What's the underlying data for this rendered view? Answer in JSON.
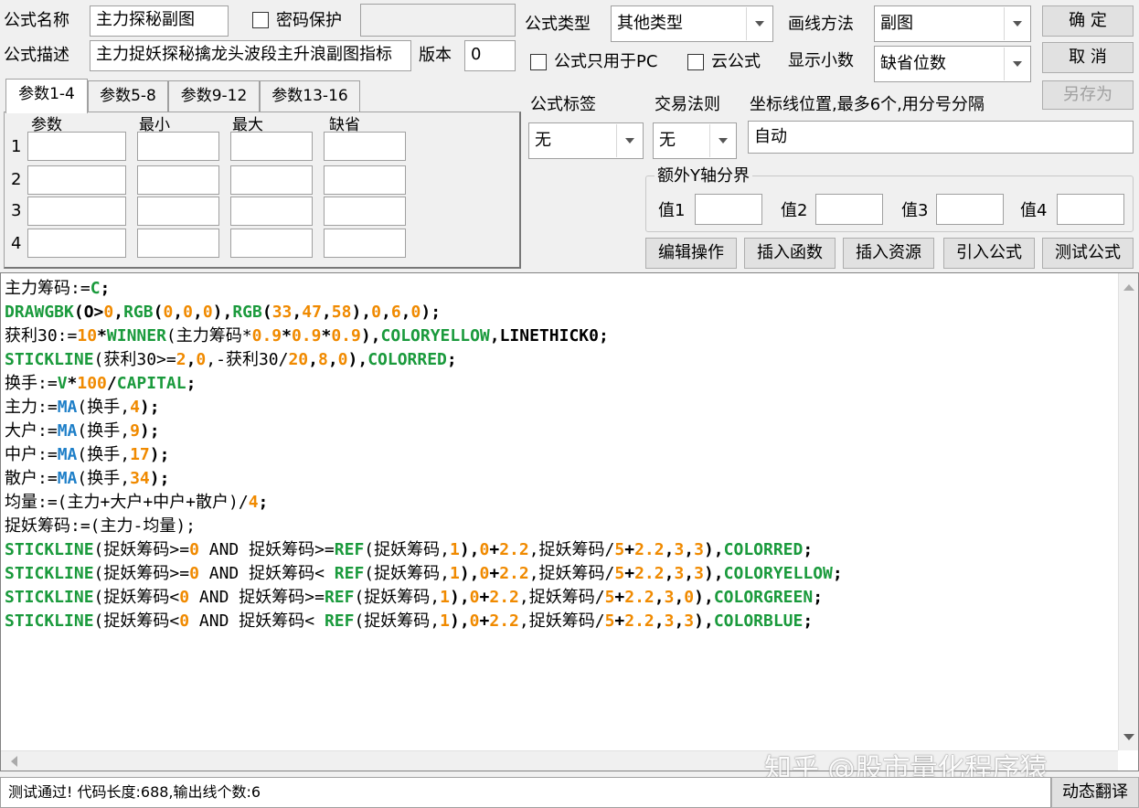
{
  "header": {
    "name_label": "公式名称",
    "name_value": "主力探秘副图",
    "pwd_label": "密码保护",
    "desc_label": "公式描述",
    "desc_value": "主力捉妖探秘擒龙头波段主升浪副图指标",
    "version_label": "版本",
    "version_value": "0"
  },
  "formula_type": {
    "label": "公式类型",
    "value": "其他类型"
  },
  "draw_method": {
    "label": "画线方法",
    "value": "副图"
  },
  "pc_only_label": "公式只用于PC",
  "cloud_label": "云公式",
  "decimals": {
    "label": "显示小数",
    "value": "缺省位数"
  },
  "buttons": {
    "ok": "确  定",
    "cancel": "取  消",
    "save_as": "另存为"
  },
  "tabs": [
    "参数1-4",
    "参数5-8",
    "参数9-12",
    "参数13-16"
  ],
  "param_headers": [
    "参数",
    "最小",
    "最大",
    "缺省"
  ],
  "param_rows": [
    "1",
    "2",
    "3",
    "4"
  ],
  "tag": {
    "label": "公式标签",
    "value": "无"
  },
  "trade_rule": {
    "label": "交易法则",
    "value": "无"
  },
  "coord": {
    "label": "坐标线位置,最多6个,用分号分隔",
    "value": "自动"
  },
  "yaxis": {
    "label": "额外Y轴分界",
    "v1": "值1",
    "v2": "值2",
    "v3": "值3",
    "v4": "值4"
  },
  "actions": [
    "编辑操作",
    "插入函数",
    "插入资源",
    "引入公式",
    "测试公式"
  ],
  "colors": {
    "func": "#1a9a3c",
    "num": "#f08a00",
    "kw": "#1e7fc8",
    "text": "#000000"
  },
  "code_lines": [
    [
      [
        "主力筹码:=",
        "t"
      ],
      [
        "C",
        "f"
      ],
      [
        ";",
        "t"
      ]
    ],
    [
      [
        "DRAWGBK",
        "f"
      ],
      [
        "(",
        "t"
      ],
      [
        "O",
        "t"
      ],
      [
        ">",
        "t"
      ],
      [
        "0",
        "n"
      ],
      [
        ",",
        "t"
      ],
      [
        "RGB",
        "f"
      ],
      [
        "(",
        "t"
      ],
      [
        "0",
        "n"
      ],
      [
        ",",
        "t"
      ],
      [
        "0",
        "n"
      ],
      [
        ",",
        "t"
      ],
      [
        "0",
        "n"
      ],
      [
        "),",
        "t"
      ],
      [
        "RGB",
        "f"
      ],
      [
        "(",
        "t"
      ],
      [
        "33",
        "n"
      ],
      [
        ",",
        "t"
      ],
      [
        "47",
        "n"
      ],
      [
        ",",
        "t"
      ],
      [
        "58",
        "n"
      ],
      [
        "),",
        "t"
      ],
      [
        "0",
        "n"
      ],
      [
        ",",
        "t"
      ],
      [
        "6",
        "n"
      ],
      [
        ",",
        "t"
      ],
      [
        "0",
        "n"
      ],
      [
        ");",
        "t"
      ]
    ],
    [
      [
        "获利30:=",
        "t"
      ],
      [
        "10",
        "n"
      ],
      [
        "*",
        "t"
      ],
      [
        "WINNER",
        "f"
      ],
      [
        "(主力筹码*",
        "t"
      ],
      [
        "0.9",
        "n"
      ],
      [
        "*",
        "t"
      ],
      [
        "0.9",
        "n"
      ],
      [
        "*",
        "t"
      ],
      [
        "0.9",
        "n"
      ],
      [
        "),",
        "t"
      ],
      [
        "COLORYELLOW",
        "f"
      ],
      [
        ",LINETHICK0;",
        "t"
      ]
    ],
    [
      [
        "STICKLINE",
        "f"
      ],
      [
        "(获利30>=",
        "t"
      ],
      [
        "2",
        "n"
      ],
      [
        ",",
        "t"
      ],
      [
        "0",
        "n"
      ],
      [
        ",-获利30/",
        "t"
      ],
      [
        "20",
        "n"
      ],
      [
        ",",
        "t"
      ],
      [
        "8",
        "n"
      ],
      [
        ",",
        "t"
      ],
      [
        "0",
        "n"
      ],
      [
        "),",
        "t"
      ],
      [
        "COLORRED",
        "f"
      ],
      [
        ";",
        "t"
      ]
    ],
    [
      [
        "换手:=",
        "t"
      ],
      [
        "V",
        "f"
      ],
      [
        "*",
        "t"
      ],
      [
        "100",
        "n"
      ],
      [
        "/",
        "t"
      ],
      [
        "CAPITAL",
        "f"
      ],
      [
        ";",
        "t"
      ]
    ],
    [
      [
        "主力:=",
        "t"
      ],
      [
        "MA",
        "k"
      ],
      [
        "(换手,",
        "t"
      ],
      [
        "4",
        "n"
      ],
      [
        ");",
        "t"
      ]
    ],
    [
      [
        "大户:=",
        "t"
      ],
      [
        "MA",
        "k"
      ],
      [
        "(换手,",
        "t"
      ],
      [
        "9",
        "n"
      ],
      [
        ");",
        "t"
      ]
    ],
    [
      [
        "中户:=",
        "t"
      ],
      [
        "MA",
        "k"
      ],
      [
        "(换手,",
        "t"
      ],
      [
        "17",
        "n"
      ],
      [
        ");",
        "t"
      ]
    ],
    [
      [
        "散户:=",
        "t"
      ],
      [
        "MA",
        "k"
      ],
      [
        "(换手,",
        "t"
      ],
      [
        "34",
        "n"
      ],
      [
        ");",
        "t"
      ]
    ],
    [
      [
        "均量:=(主力+大户+中户+散户)/",
        "t"
      ],
      [
        "4",
        "n"
      ],
      [
        ";",
        "t"
      ]
    ],
    [
      [
        "捉妖筹码:=(主力-均量);",
        "t"
      ]
    ],
    [
      [
        "STICKLINE",
        "f"
      ],
      [
        "(捉妖筹码>=",
        "t"
      ],
      [
        "0",
        "n"
      ],
      [
        " AND 捉妖筹码>=",
        "t"
      ],
      [
        "REF",
        "f"
      ],
      [
        "(捉妖筹码,",
        "t"
      ],
      [
        "1",
        "n"
      ],
      [
        "),",
        "t"
      ],
      [
        "0",
        "n"
      ],
      [
        "+",
        "t"
      ],
      [
        "2.2",
        "n"
      ],
      [
        ",捉妖筹码/",
        "t"
      ],
      [
        "5",
        "n"
      ],
      [
        "+",
        "t"
      ],
      [
        "2.2",
        "n"
      ],
      [
        ",",
        "t"
      ],
      [
        "3",
        "n"
      ],
      [
        ",",
        "t"
      ],
      [
        "3",
        "n"
      ],
      [
        "),",
        "t"
      ],
      [
        "COLORRED",
        "f"
      ],
      [
        ";",
        "t"
      ]
    ],
    [
      [
        "STICKLINE",
        "f"
      ],
      [
        "(捉妖筹码>=",
        "t"
      ],
      [
        "0",
        "n"
      ],
      [
        " AND 捉妖筹码< ",
        "t"
      ],
      [
        "REF",
        "f"
      ],
      [
        "(捉妖筹码,",
        "t"
      ],
      [
        "1",
        "n"
      ],
      [
        "),",
        "t"
      ],
      [
        "0",
        "n"
      ],
      [
        "+",
        "t"
      ],
      [
        "2.2",
        "n"
      ],
      [
        ",捉妖筹码/",
        "t"
      ],
      [
        "5",
        "n"
      ],
      [
        "+",
        "t"
      ],
      [
        "2.2",
        "n"
      ],
      [
        ",",
        "t"
      ],
      [
        "3",
        "n"
      ],
      [
        ",",
        "t"
      ],
      [
        "3",
        "n"
      ],
      [
        "),",
        "t"
      ],
      [
        "COLORYELLOW",
        "f"
      ],
      [
        ";",
        "t"
      ]
    ],
    [
      [
        "STICKLINE",
        "f"
      ],
      [
        "(捉妖筹码<",
        "t"
      ],
      [
        "0",
        "n"
      ],
      [
        " AND 捉妖筹码>=",
        "t"
      ],
      [
        "REF",
        "f"
      ],
      [
        "(捉妖筹码,",
        "t"
      ],
      [
        "1",
        "n"
      ],
      [
        "),",
        "t"
      ],
      [
        "0",
        "n"
      ],
      [
        "+",
        "t"
      ],
      [
        "2.2",
        "n"
      ],
      [
        ",捉妖筹码/",
        "t"
      ],
      [
        "5",
        "n"
      ],
      [
        "+",
        "t"
      ],
      [
        "2.2",
        "n"
      ],
      [
        ",",
        "t"
      ],
      [
        "3",
        "n"
      ],
      [
        ",",
        "t"
      ],
      [
        "0",
        "n"
      ],
      [
        "),",
        "t"
      ],
      [
        "COLORGREEN",
        "f"
      ],
      [
        ";",
        "t"
      ]
    ],
    [
      [
        "STICKLINE",
        "f"
      ],
      [
        "(捉妖筹码<",
        "t"
      ],
      [
        "0",
        "n"
      ],
      [
        " AND 捉妖筹码< ",
        "t"
      ],
      [
        "REF",
        "f"
      ],
      [
        "(捉妖筹码,",
        "t"
      ],
      [
        "1",
        "n"
      ],
      [
        "),",
        "t"
      ],
      [
        "0",
        "n"
      ],
      [
        "+",
        "t"
      ],
      [
        "2.2",
        "n"
      ],
      [
        ",捉妖筹码/",
        "t"
      ],
      [
        "5",
        "n"
      ],
      [
        "+",
        "t"
      ],
      [
        "2.2",
        "n"
      ],
      [
        ",",
        "t"
      ],
      [
        "3",
        "n"
      ],
      [
        ",",
        "t"
      ],
      [
        "3",
        "n"
      ],
      [
        "),",
        "t"
      ],
      [
        "COLORBLUE",
        "f"
      ],
      [
        ";",
        "t"
      ]
    ]
  ],
  "status": "测试通过! 代码长度:688,输出线个数:6",
  "dyn_translate": "动态翻译",
  "watermark": "知乎 @股市量化程序猿"
}
